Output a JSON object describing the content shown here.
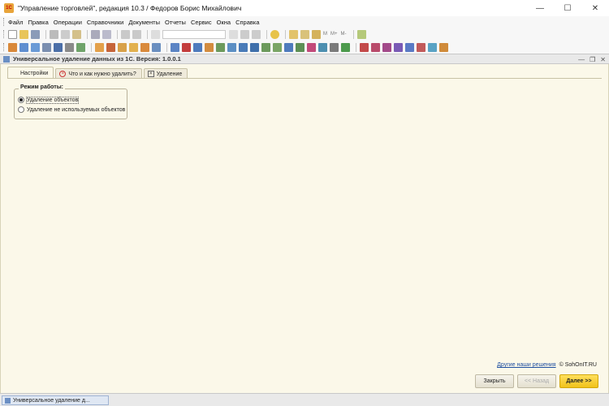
{
  "window": {
    "title": "\"Управление торговлей\", редакция 10.3 / Федоров Борис Михайлович",
    "controls": [
      "minimize",
      "maximize",
      "close"
    ]
  },
  "menu": [
    "Файл",
    "Правка",
    "Операции",
    "Справочники",
    "Документы",
    "Отчеты",
    "Сервис",
    "Окна",
    "Справка"
  ],
  "toolbar": {
    "memory_buttons": [
      "M",
      "M+",
      "M-"
    ]
  },
  "document": {
    "title": "Универсальное удаление данных из 1С. Версия: 1.0.0.1",
    "tabs": [
      {
        "label": "Настройки",
        "active": true
      },
      {
        "label": "Что и как нужно удалить?",
        "active": false
      },
      {
        "label": "Удаление",
        "active": false
      }
    ],
    "mode_group": {
      "title": "Режим работы:",
      "options": [
        {
          "label": "Удаление объектов",
          "selected": true
        },
        {
          "label": "Удаление не используемых объектов",
          "selected": false
        }
      ]
    },
    "footer": {
      "link": "Другие наши решения",
      "copyright": "© SohOnIT.RU"
    },
    "buttons": {
      "close": "Закрыть",
      "back": "<< Назад",
      "next": "Далее >>"
    }
  },
  "taskbar": {
    "item": "Универсальное удаление д..."
  },
  "colors": {
    "form_background": "#fbf8e9",
    "primary_button": "#f1c21b",
    "link": "#1f4fa0"
  }
}
